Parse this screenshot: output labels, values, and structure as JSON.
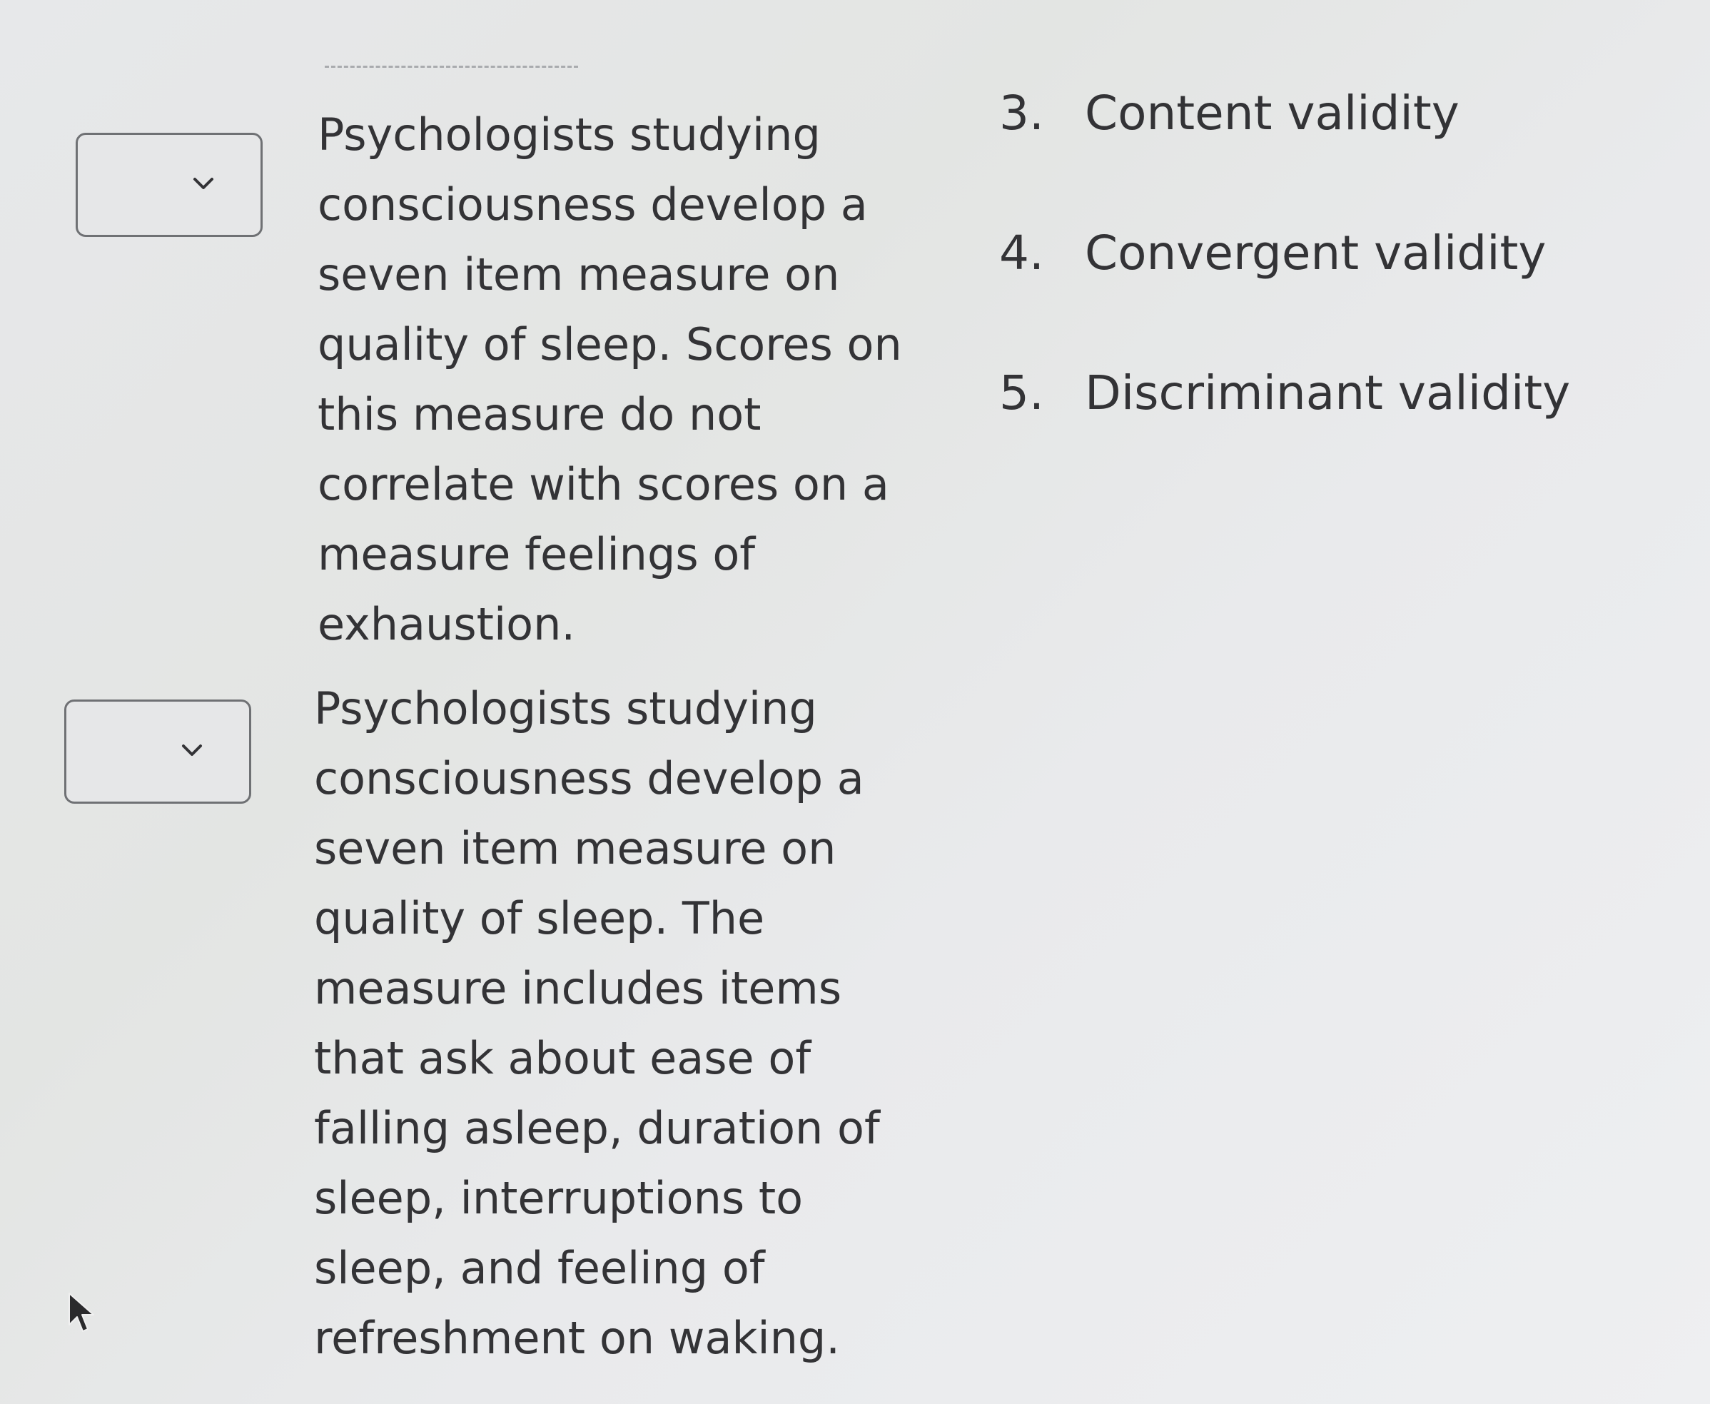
{
  "matching": {
    "rows": [
      {
        "dropdown_value": "",
        "prompt": "Psychologists studying consciousness develop a seven item measure on quality of sleep. Scores on this measure do not correlate with scores on a measure feelings of exhaustion."
      },
      {
        "dropdown_value": "",
        "prompt": "Psychologists studying consciousness develop a seven item measure on quality of sleep. The measure includes items that ask about ease of falling asleep, duration of sleep, interruptions to sleep, and feeling of refreshment on waking."
      }
    ],
    "options": [
      {
        "number": "3.",
        "label": "Content validity"
      },
      {
        "number": "4.",
        "label": "Convergent validity"
      },
      {
        "number": "5.",
        "label": "Discriminant validity"
      }
    ]
  },
  "icons": {
    "dropdown_chevron": "chevron-down-icon",
    "pointer": "mouse-pointer-icon"
  }
}
